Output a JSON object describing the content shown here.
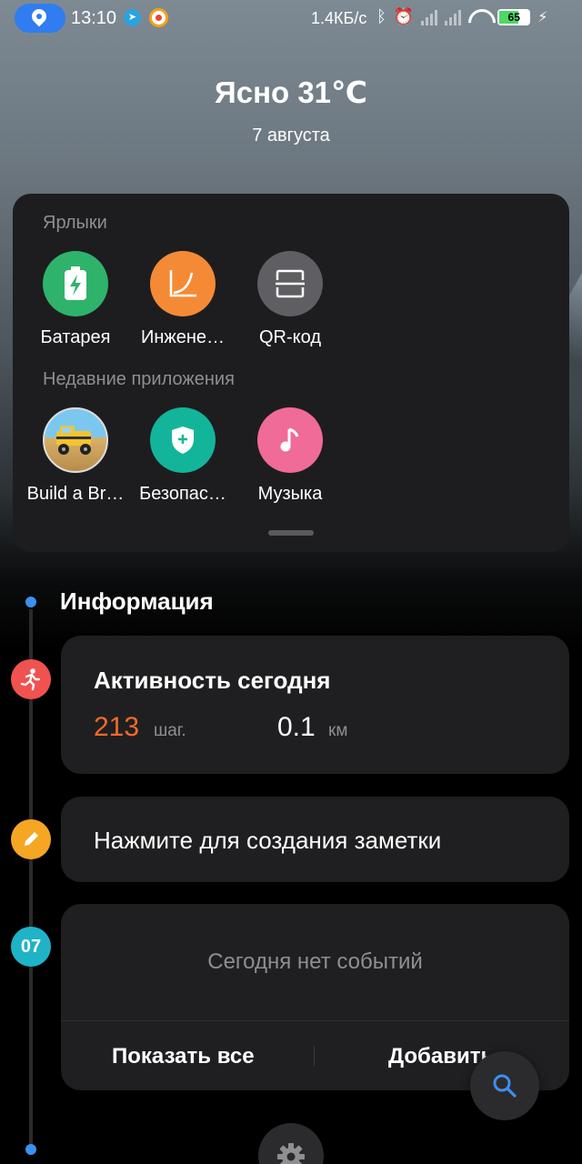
{
  "status_bar": {
    "time": "13:10",
    "net_speed": "1.4КБ/с",
    "battery": "65",
    "icons": [
      "location-icon",
      "telegram-icon",
      "notification-app-icon",
      "bluetooth-icon",
      "alarm-icon",
      "signal-icon",
      "signal-icon",
      "wifi-icon",
      "battery-icon",
      "charging-icon"
    ]
  },
  "weather": {
    "title": "Ясно 31℃",
    "date": "7 августа"
  },
  "shortcuts": {
    "label": "Ярлыки",
    "items": [
      {
        "label": "Батарея",
        "icon": "battery-icon",
        "color": "#2fb36b"
      },
      {
        "label": "Инжене…",
        "icon": "calculator-curve-icon",
        "color": "#f58a36"
      },
      {
        "label": "QR-код",
        "icon": "qr-scan-icon",
        "color": "#5f5f63"
      }
    ]
  },
  "recent_apps": {
    "label": "Недавние приложения",
    "items": [
      {
        "label": "Build a Br…",
        "icon": "game-truck-icon"
      },
      {
        "label": "Безопас…",
        "icon": "security-shield-icon",
        "color": "#13b59a"
      },
      {
        "label": "Музыка",
        "icon": "music-note-icon",
        "color": "#f06b97"
      }
    ]
  },
  "info": {
    "title": "Информация",
    "activity": {
      "title": "Активность сегодня",
      "steps": "213",
      "steps_unit": "шаг.",
      "distance": "0.1",
      "distance_unit": "км",
      "icon_color": "#f0524f"
    },
    "note": {
      "text": "Нажмите для создания заметки",
      "icon_color": "#f5a623"
    },
    "calendar": {
      "day": "07",
      "empty_text": "Сегодня нет событий",
      "show_all": "Показать все",
      "add": "Добавить",
      "icon_color": "#1fb3c8"
    }
  }
}
